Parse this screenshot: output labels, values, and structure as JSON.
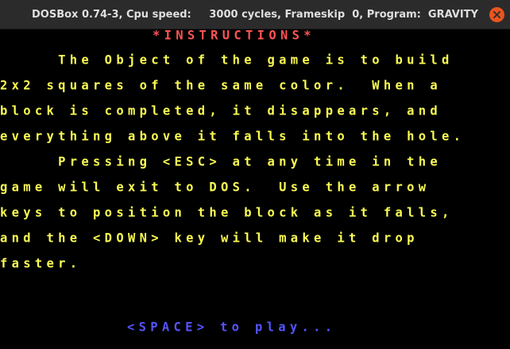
{
  "window": {
    "title": "DOSBox 0.74-3, Cpu speed:     3000 cycles, Frameskip  0, Program:  GRAVITY",
    "close_icon": "close-icon"
  },
  "game": {
    "heading": "*INSTRUCTIONS*",
    "lines": [
      "     The Object of the game is to build",
      "2x2 squares of the same color.  When a",
      "block is completed, it disappears, and",
      "everything above it falls into the hole.",
      "     Pressing <ESC> at any time in the",
      "game will exit to DOS.  Use the arrow",
      "keys to position the block as it falls,",
      "and the <DOWN> key will make it drop",
      "faster."
    ],
    "prompt": "<SPACE> to play...",
    "colors": {
      "heading": "#fb5454",
      "body": "#fbfb54",
      "prompt": "#5454fb",
      "background": "#000000"
    }
  }
}
